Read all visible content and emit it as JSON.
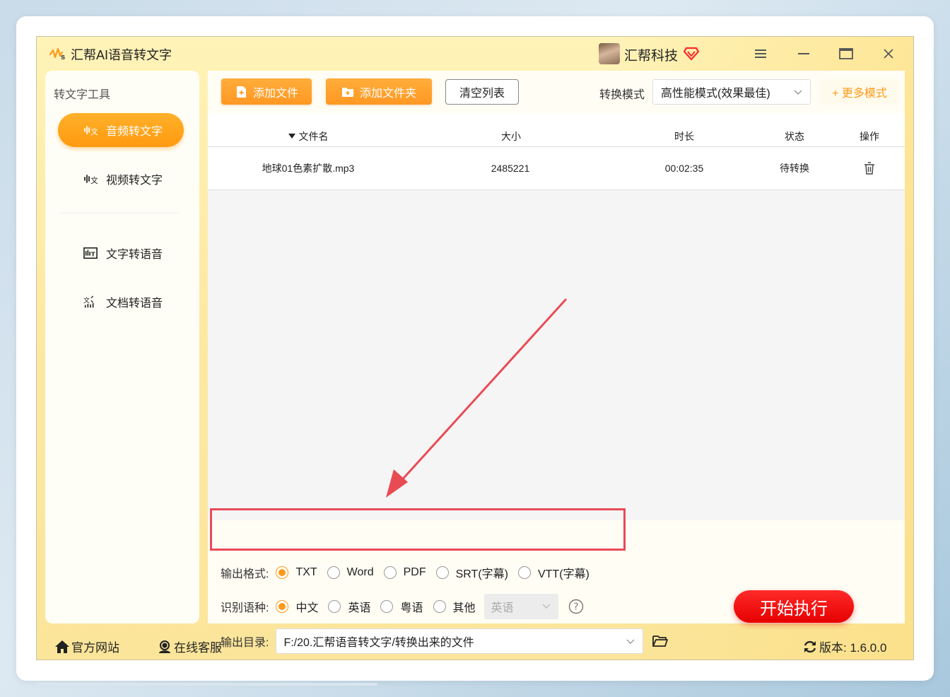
{
  "app": {
    "title": "汇帮AI语音转文字",
    "brand": "汇帮科技"
  },
  "sidebar": {
    "title": "转文字工具",
    "items": [
      {
        "label": "音频转文字",
        "active": true
      },
      {
        "label": "视频转文字",
        "active": false
      },
      {
        "label": "文字转语音",
        "active": false
      },
      {
        "label": "文档转语音",
        "active": false
      }
    ]
  },
  "toolbar": {
    "add_file": "添加文件",
    "add_folder": "添加文件夹",
    "clear_list": "清空列表",
    "mode_label": "转换模式",
    "mode_value": "高性能模式(效果最佳)",
    "more_modes": "+ 更多模式"
  },
  "table": {
    "headers": [
      "文件名",
      "大小",
      "时长",
      "状态",
      "操作"
    ],
    "rows": [
      {
        "filename": "地球01色素扩散.mp3",
        "size": "2485221",
        "duration": "00:02:35",
        "status": "待转换"
      }
    ]
  },
  "options": {
    "format_label": "输出格式:",
    "formats": [
      {
        "label": "TXT",
        "selected": true
      },
      {
        "label": "Word",
        "selected": false
      },
      {
        "label": "PDF",
        "selected": false
      },
      {
        "label": "SRT(字幕)",
        "selected": false
      },
      {
        "label": "VTT(字幕)",
        "selected": false
      }
    ],
    "lang_label": "识别语种:",
    "langs": [
      {
        "label": "中文",
        "selected": true
      },
      {
        "label": "英语",
        "selected": false
      },
      {
        "label": "粤语",
        "selected": false
      },
      {
        "label": "其他",
        "selected": false
      }
    ],
    "other_lang_value": "英语",
    "dir_label": "输出目录:",
    "dir_value": "F:/20.汇帮语音转文字/转换出来的文件"
  },
  "start_button": "开始执行",
  "footer": {
    "website": "官方网站",
    "support": "在线客服",
    "version": "版本: 1.6.0.0"
  },
  "colors": {
    "accent": "#ff9a1a",
    "start": "#e60000",
    "highlight": "#e94b55"
  }
}
